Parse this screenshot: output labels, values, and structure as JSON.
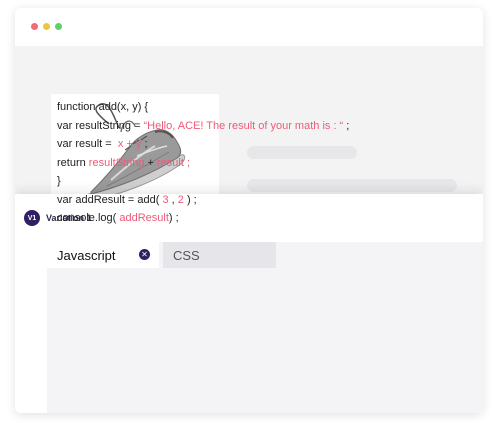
{
  "window_controls": {
    "close_color": "#f2697b",
    "minimize_color": "#e9c93b",
    "maximize_color": "#5fd06a"
  },
  "variation": {
    "badge": "V1",
    "name": "Variation 1"
  },
  "tabs": [
    {
      "label": "Javascript",
      "active": true
    },
    {
      "label": "CSS",
      "active": false
    }
  ],
  "code": {
    "l1": "function add(x, y) {",
    "l2_a": "var resultString = ",
    "l2_b": "“Hello, ACE! The result of your math is : “",
    "l2_c": " ;",
    "l3_a": "var result = ",
    "l3_b": " x + y ",
    "l3_c": ";",
    "l4_a": "return ",
    "l4_b": "resultString",
    "l4_c": " + ",
    "l4_d": "result ;",
    "l5": "}",
    "l6_a": "var addResult = add(",
    "l6_b": " 3 ",
    "l6_c": ",",
    "l6_d": " 2 ",
    "l6_e": ") ;",
    "l7_a": "console.log(",
    "l7_b": " addResult",
    "l7_c": ") ;"
  },
  "colors": {
    "accent": "#2f1f63",
    "string": "#ef5a78"
  }
}
